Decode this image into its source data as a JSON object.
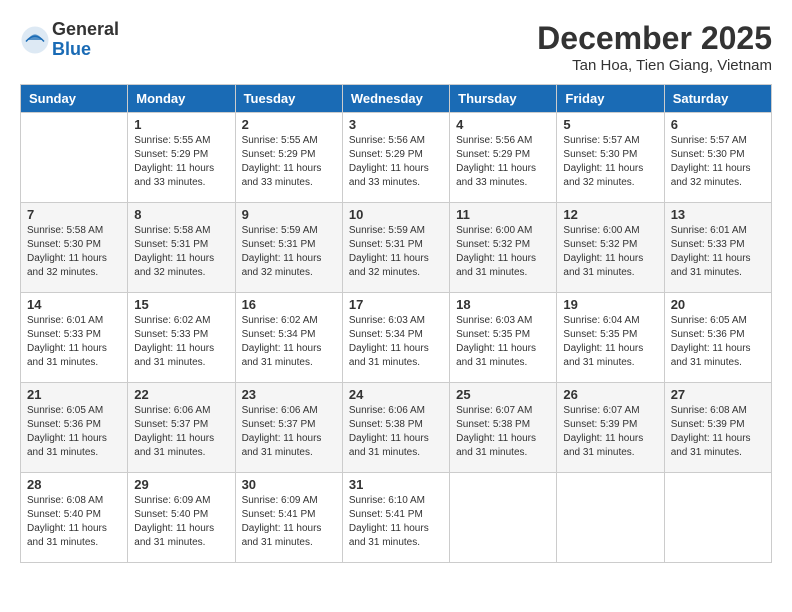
{
  "logo": {
    "general": "General",
    "blue": "Blue"
  },
  "title": "December 2025",
  "location": "Tan Hoa, Tien Giang, Vietnam",
  "days_of_week": [
    "Sunday",
    "Monday",
    "Tuesday",
    "Wednesday",
    "Thursday",
    "Friday",
    "Saturday"
  ],
  "weeks": [
    [
      {
        "num": "",
        "info": ""
      },
      {
        "num": "1",
        "info": "Sunrise: 5:55 AM\nSunset: 5:29 PM\nDaylight: 11 hours\nand 33 minutes."
      },
      {
        "num": "2",
        "info": "Sunrise: 5:55 AM\nSunset: 5:29 PM\nDaylight: 11 hours\nand 33 minutes."
      },
      {
        "num": "3",
        "info": "Sunrise: 5:56 AM\nSunset: 5:29 PM\nDaylight: 11 hours\nand 33 minutes."
      },
      {
        "num": "4",
        "info": "Sunrise: 5:56 AM\nSunset: 5:29 PM\nDaylight: 11 hours\nand 33 minutes."
      },
      {
        "num": "5",
        "info": "Sunrise: 5:57 AM\nSunset: 5:30 PM\nDaylight: 11 hours\nand 32 minutes."
      },
      {
        "num": "6",
        "info": "Sunrise: 5:57 AM\nSunset: 5:30 PM\nDaylight: 11 hours\nand 32 minutes."
      }
    ],
    [
      {
        "num": "7",
        "info": "Sunrise: 5:58 AM\nSunset: 5:30 PM\nDaylight: 11 hours\nand 32 minutes."
      },
      {
        "num": "8",
        "info": "Sunrise: 5:58 AM\nSunset: 5:31 PM\nDaylight: 11 hours\nand 32 minutes."
      },
      {
        "num": "9",
        "info": "Sunrise: 5:59 AM\nSunset: 5:31 PM\nDaylight: 11 hours\nand 32 minutes."
      },
      {
        "num": "10",
        "info": "Sunrise: 5:59 AM\nSunset: 5:31 PM\nDaylight: 11 hours\nand 32 minutes."
      },
      {
        "num": "11",
        "info": "Sunrise: 6:00 AM\nSunset: 5:32 PM\nDaylight: 11 hours\nand 31 minutes."
      },
      {
        "num": "12",
        "info": "Sunrise: 6:00 AM\nSunset: 5:32 PM\nDaylight: 11 hours\nand 31 minutes."
      },
      {
        "num": "13",
        "info": "Sunrise: 6:01 AM\nSunset: 5:33 PM\nDaylight: 11 hours\nand 31 minutes."
      }
    ],
    [
      {
        "num": "14",
        "info": "Sunrise: 6:01 AM\nSunset: 5:33 PM\nDaylight: 11 hours\nand 31 minutes."
      },
      {
        "num": "15",
        "info": "Sunrise: 6:02 AM\nSunset: 5:33 PM\nDaylight: 11 hours\nand 31 minutes."
      },
      {
        "num": "16",
        "info": "Sunrise: 6:02 AM\nSunset: 5:34 PM\nDaylight: 11 hours\nand 31 minutes."
      },
      {
        "num": "17",
        "info": "Sunrise: 6:03 AM\nSunset: 5:34 PM\nDaylight: 11 hours\nand 31 minutes."
      },
      {
        "num": "18",
        "info": "Sunrise: 6:03 AM\nSunset: 5:35 PM\nDaylight: 11 hours\nand 31 minutes."
      },
      {
        "num": "19",
        "info": "Sunrise: 6:04 AM\nSunset: 5:35 PM\nDaylight: 11 hours\nand 31 minutes."
      },
      {
        "num": "20",
        "info": "Sunrise: 6:05 AM\nSunset: 5:36 PM\nDaylight: 11 hours\nand 31 minutes."
      }
    ],
    [
      {
        "num": "21",
        "info": "Sunrise: 6:05 AM\nSunset: 5:36 PM\nDaylight: 11 hours\nand 31 minutes."
      },
      {
        "num": "22",
        "info": "Sunrise: 6:06 AM\nSunset: 5:37 PM\nDaylight: 11 hours\nand 31 minutes."
      },
      {
        "num": "23",
        "info": "Sunrise: 6:06 AM\nSunset: 5:37 PM\nDaylight: 11 hours\nand 31 minutes."
      },
      {
        "num": "24",
        "info": "Sunrise: 6:06 AM\nSunset: 5:38 PM\nDaylight: 11 hours\nand 31 minutes."
      },
      {
        "num": "25",
        "info": "Sunrise: 6:07 AM\nSunset: 5:38 PM\nDaylight: 11 hours\nand 31 minutes."
      },
      {
        "num": "26",
        "info": "Sunrise: 6:07 AM\nSunset: 5:39 PM\nDaylight: 11 hours\nand 31 minutes."
      },
      {
        "num": "27",
        "info": "Sunrise: 6:08 AM\nSunset: 5:39 PM\nDaylight: 11 hours\nand 31 minutes."
      }
    ],
    [
      {
        "num": "28",
        "info": "Sunrise: 6:08 AM\nSunset: 5:40 PM\nDaylight: 11 hours\nand 31 minutes."
      },
      {
        "num": "29",
        "info": "Sunrise: 6:09 AM\nSunset: 5:40 PM\nDaylight: 11 hours\nand 31 minutes."
      },
      {
        "num": "30",
        "info": "Sunrise: 6:09 AM\nSunset: 5:41 PM\nDaylight: 11 hours\nand 31 minutes."
      },
      {
        "num": "31",
        "info": "Sunrise: 6:10 AM\nSunset: 5:41 PM\nDaylight: 11 hours\nand 31 minutes."
      },
      {
        "num": "",
        "info": ""
      },
      {
        "num": "",
        "info": ""
      },
      {
        "num": "",
        "info": ""
      }
    ]
  ]
}
